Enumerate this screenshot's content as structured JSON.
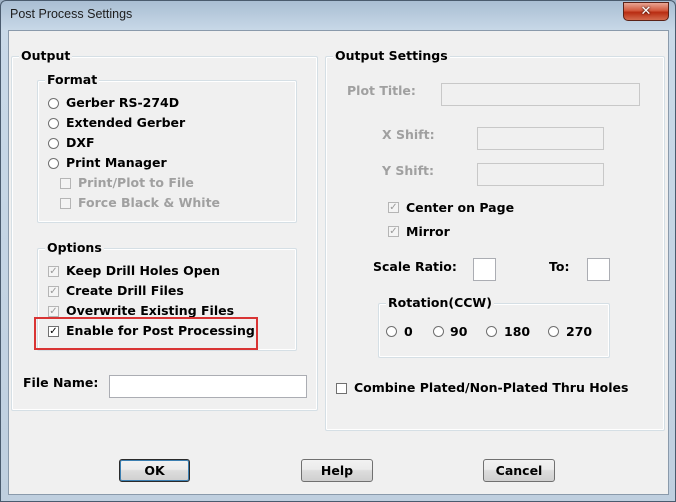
{
  "window": {
    "title": "Post Process Settings",
    "close_symbol": "✕"
  },
  "output": {
    "label": "Output",
    "format": {
      "label": "Format",
      "options": [
        "Gerber RS-274D",
        "Extended Gerber",
        "DXF",
        "Print Manager"
      ],
      "sub_options": [
        "Print/Plot to File",
        "Force Black & White"
      ]
    },
    "options": {
      "label": "Options",
      "items": [
        {
          "label": "Keep Drill Holes Open",
          "checked": true,
          "disabled": true
        },
        {
          "label": "Create Drill Files",
          "checked": true,
          "disabled": true
        },
        {
          "label": "Overwrite Existing Files",
          "checked": true,
          "disabled": true
        },
        {
          "label": "Enable for Post Processing",
          "checked": true,
          "disabled": false
        }
      ]
    },
    "file_name_label": "File Name:",
    "file_name_value": ""
  },
  "output_settings": {
    "label": "Output Settings",
    "plot_title_label": "Plot Title:",
    "x_shift_label": "X Shift:",
    "y_shift_label": "Y Shift:",
    "center_on_page_label": "Center on Page",
    "mirror_label": "Mirror",
    "scale_ratio_label": "Scale Ratio:",
    "to_label": "To:",
    "rotation": {
      "label": "Rotation(CCW)",
      "options": [
        "0",
        "90",
        "180",
        "270"
      ]
    },
    "combine_label": "Combine Plated/Non-Plated Thru Holes"
  },
  "buttons": {
    "ok": "OK",
    "help": "Help",
    "cancel": "Cancel"
  },
  "colors": {
    "highlight": "#d93434",
    "close": "#c7432a"
  }
}
